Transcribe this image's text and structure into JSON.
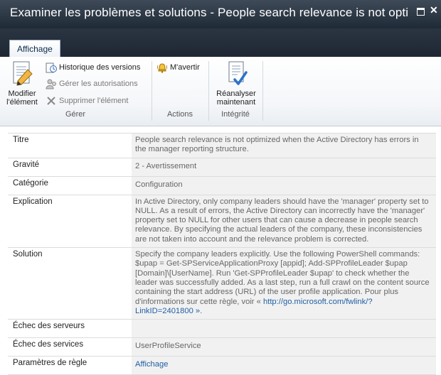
{
  "window": {
    "title": "Examiner les problèmes et solutions - People search relevance is not optimiz...",
    "maximize_icon": "maximize-icon",
    "close_icon": "close-icon",
    "close_glyph": "✕"
  },
  "ribbon": {
    "tab": "Affichage",
    "groups": {
      "manage": {
        "label": "Gérer",
        "edit_item": {
          "line1": "Modifier",
          "line2": "l'élément",
          "icon": "edit-document-icon"
        },
        "version_history": {
          "label": "Historique des versions",
          "icon": "version-history-icon"
        },
        "manage_permissions": {
          "label": "Gérer les autorisations",
          "icon": "permissions-icon"
        },
        "delete_item": {
          "label": "Supprimer l'élément",
          "icon": "delete-icon"
        }
      },
      "actions": {
        "label": "Actions",
        "alert_me": {
          "label": "M'avertir",
          "icon": "alert-bell-icon"
        }
      },
      "integrity": {
        "label": "Intégrité",
        "reanalyze": {
          "line1": "Réanalyser",
          "line2": "maintenant",
          "icon": "reanalyze-document-icon"
        }
      }
    }
  },
  "fields": {
    "titre": {
      "label": "Titre",
      "value": "People search relevance is not optimized when the Active Directory has errors in the manager reporting structure."
    },
    "gravite": {
      "label": "Gravité",
      "value": "2 - Avertissement"
    },
    "categorie": {
      "label": "Catégorie",
      "value": "Configuration"
    },
    "explication": {
      "label": "Explication",
      "value": "In Active Directory, only company leaders should have the 'manager' property set to NULL. As a result of errors, the Active Directory can incorrectly have the 'manager' property set to NULL for other users that can cause a decrease in people search relevance. By specifying the actual leaders of the company, these inconsistencies are not taken into account and the relevance problem is corrected."
    },
    "solution": {
      "label": "Solution",
      "value": "Specify the company leaders explicitly. Use the following PowerShell commands: $upap = Get-SPServiceApplicationProxy [appid]; Add-SPProfileLeader $upap [Domain]\\[UserName]. Run 'Get-SPProfileLeader $upap' to check whether the leader was successfully added. As a last step, run a full crawl on the content source containing the start address (URL) of the user profile application. Pour plus d'informations sur cette règle, voir «",
      "link": "http://go.microsoft.com/fwlink/?LinkID=2401800 »",
      "suffix": "."
    },
    "echec_serveurs": {
      "label": "Échec des serveurs",
      "value": ""
    },
    "echec_services": {
      "label": "Échec des services",
      "value": "UserProfileService"
    },
    "parametres_regle": {
      "label": "Paramètres de règle",
      "link": "Affichage"
    }
  }
}
